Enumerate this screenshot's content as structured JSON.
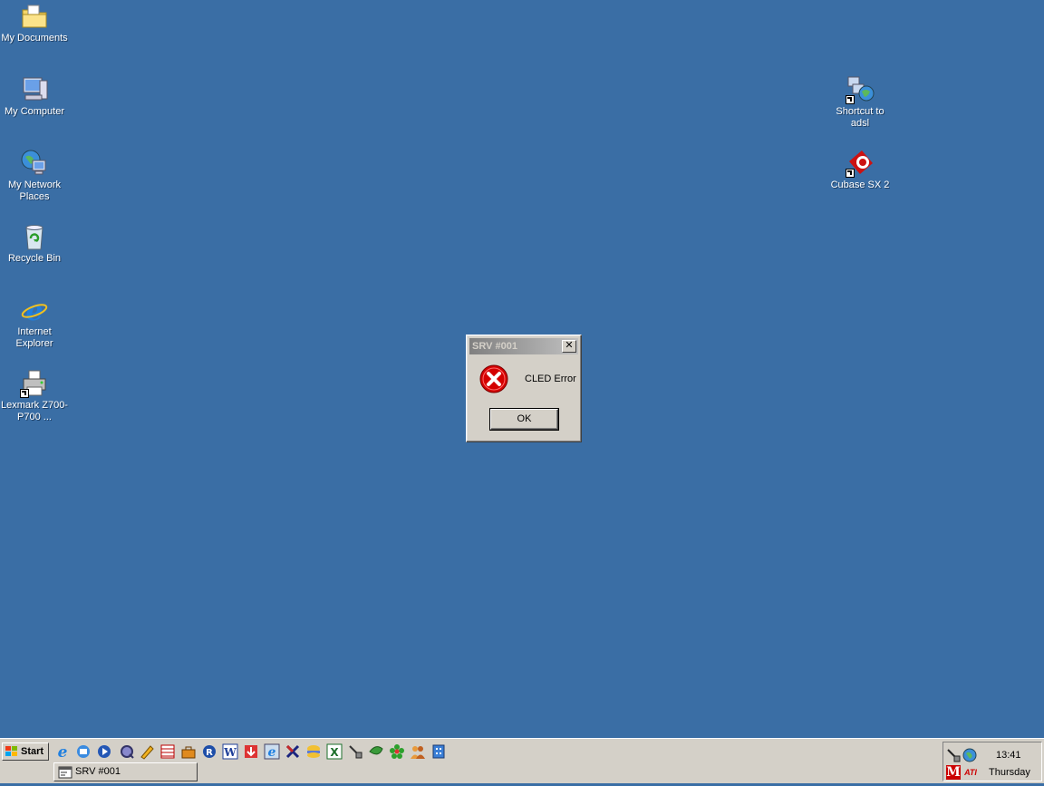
{
  "desktop": {
    "icons": [
      {
        "label": "My Documents"
      },
      {
        "label": "My Computer"
      },
      {
        "label": "My Network Places"
      },
      {
        "label": "Recycle Bin"
      },
      {
        "label": "Internet Explorer"
      },
      {
        "label": "Lexmark Z700-P700 ..."
      },
      {
        "label": "Shortcut to adsl"
      },
      {
        "label": "Cubase SX 2"
      }
    ]
  },
  "dialog": {
    "title": "SRV #001",
    "close_glyph": "✕",
    "message": "CLED Error",
    "ok_label": "OK",
    "icon": "error-icon"
  },
  "taskbar": {
    "start_label": "Start",
    "task_button_label": "SRV #001",
    "clock": "13:41",
    "day": "Thursday",
    "tray_text_m": "M",
    "tray_text_ati": "ATI"
  },
  "colors": {
    "desktop": "#3a6ea5",
    "error_red": "#d40000",
    "chrome": "#d4d0c8"
  }
}
